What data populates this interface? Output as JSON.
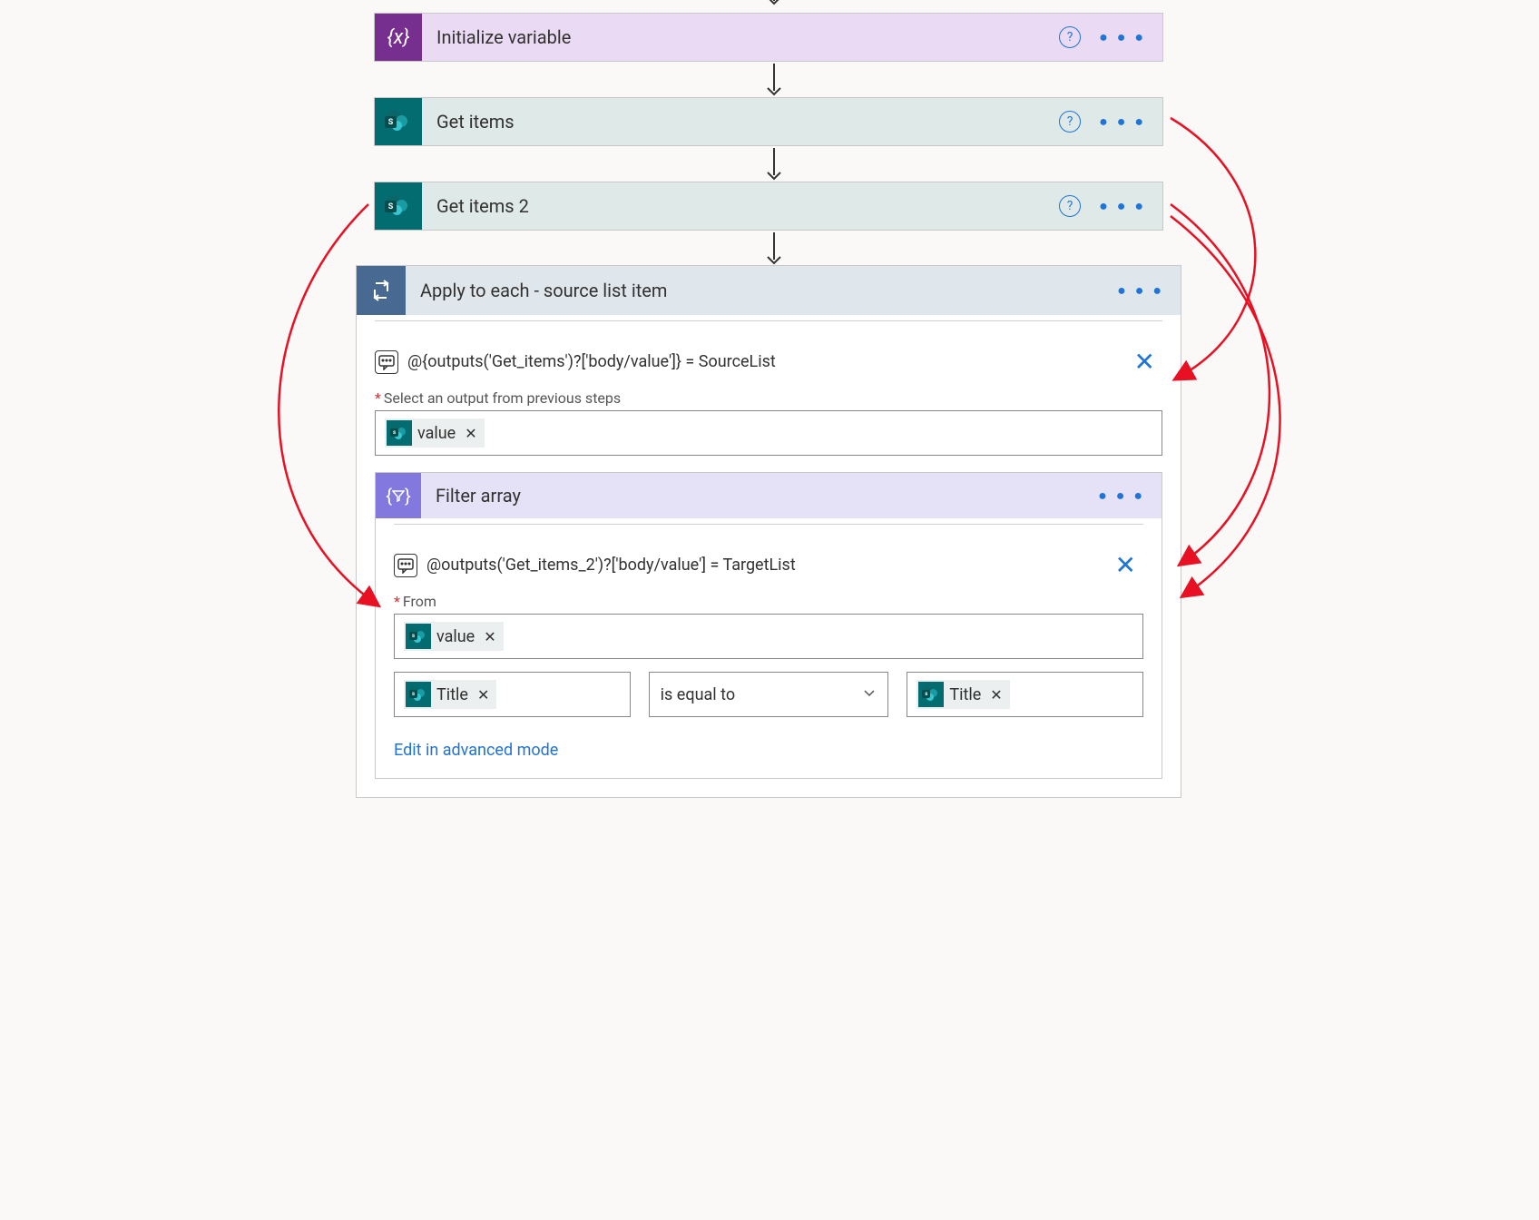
{
  "cards": {
    "init_var": {
      "title": "Initialize variable"
    },
    "get_items": {
      "title": "Get items"
    },
    "get_items_2": {
      "title": "Get items 2"
    },
    "apply_each": {
      "title": "Apply to each - source list item",
      "comment": "@{outputs('Get_items')?['body/value']} = SourceList",
      "select_label": "Select an output from previous steps",
      "token_value": "value"
    },
    "filter": {
      "title": "Filter array",
      "comment": "@outputs('Get_items_2')?['body/value'] = TargetList",
      "from_label": "From",
      "token_value": "value",
      "left_token": "Title",
      "operator": "is equal to",
      "right_token": "Title",
      "advanced_link": "Edit in advanced mode"
    }
  }
}
